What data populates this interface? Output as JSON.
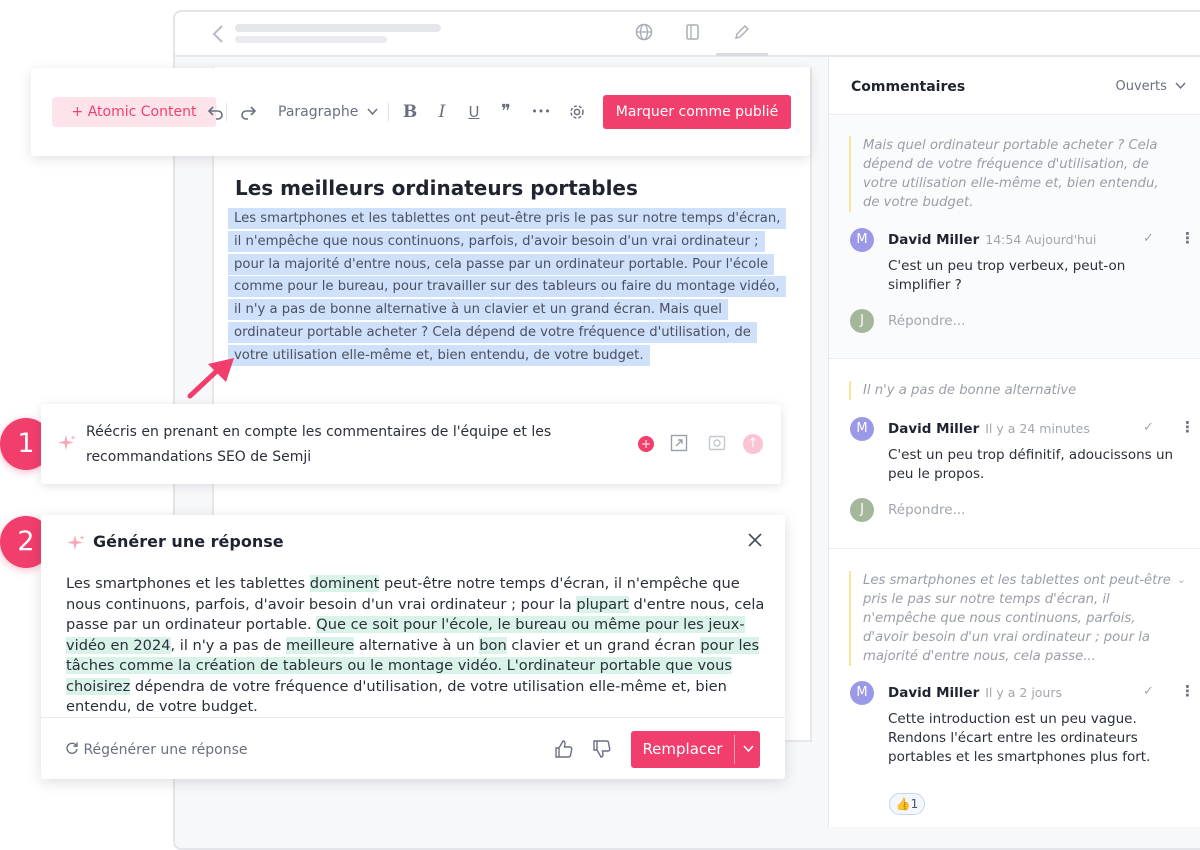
{
  "toolbar": {
    "atomic_label": "+ Atomic Content",
    "paragraph_label": "Paragraphe",
    "bold": "B",
    "italic": "I",
    "underline": "U",
    "quote": "❞",
    "more": "•••",
    "publish_label": "Marquer comme publié"
  },
  "article": {
    "title": "Les meilleurs ordinateurs portables",
    "body": "Les smartphones et les tablettes ont peut-être pris le pas sur notre temps d'écran, il n'empêche que nous continuons, parfois, d'avoir besoin d'un vrai ordinateur ; pour la majorité d'entre nous, cela passe par un ordinateur portable. Pour l'école comme pour le bureau, pour travailler sur des tableurs ou faire du montage vidéo, il n'y a pas de bonne alternative à un clavier et un grand écran. Mais quel ordinateur portable acheter ? Cela dépend de votre fréquence d'utilisation, de votre utilisation elle-même et, bien entendu, de votre budget."
  },
  "steps": {
    "one": "1",
    "two": "2"
  },
  "prompt": {
    "text": "Réécris en prenant en compte les commentaires de l'équipe et les recommandations SEO de Semji"
  },
  "generate": {
    "title": "Générer une réponse",
    "segments": [
      {
        "t": "Les smartphones et les tablettes ",
        "h": false
      },
      {
        "t": "dominent",
        "h": true
      },
      {
        "t": " peut-être notre temps d'écran, il n'empêche que nous continuons, parfois, d'avoir besoin d'un vrai ordinateur ; pour la ",
        "h": false
      },
      {
        "t": "plupart",
        "h": true
      },
      {
        "t": " d'entre nous, cela passe par un ordinateur portable. ",
        "h": false
      },
      {
        "t": "Que ce soit pour l'école, le bureau ou même pour les jeux-vidéo en 2024",
        "h": true
      },
      {
        "t": ", il n'y a pas de ",
        "h": false
      },
      {
        "t": "meilleure",
        "h": true
      },
      {
        "t": " alternative à un ",
        "h": false
      },
      {
        "t": "bon",
        "h": true
      },
      {
        "t": " clavier et un grand écran ",
        "h": false
      },
      {
        "t": "pour les tâches comme la création de tableurs ou le montage vidéo. L'ordinateur portable que vous choisirez",
        "h": true
      },
      {
        "t": " dépendra de votre fréquence d'utilisation, de votre utilisation elle-même et, bien entendu, de votre budget.",
        "h": false
      }
    ],
    "regen_label": "Régénérer une réponse",
    "replace_label": "Remplacer"
  },
  "comments": {
    "title": "Commentaires",
    "filter": "Ouverts",
    "reply_placeholder": "Répondre...",
    "threads": [
      {
        "quote": "Mais quel ordinateur portable acheter ? Cela dépend de votre fréquence d'utilisation, de votre utilisation elle-même et, bien entendu, de votre budget.",
        "author": "David Miller",
        "avatar": "M",
        "time": "14:54 Aujourd'hui",
        "text": "C'est un peu trop verbeux, peut-on simplifier ?",
        "reply_avatar": "J"
      },
      {
        "quote": "Il n'y a pas de bonne alternative",
        "author": "David Miller",
        "avatar": "M",
        "time": "Il y a 24 minutes",
        "text": "C'est un peu trop définitif, adoucissons un peu le propos.",
        "reply_avatar": "J"
      },
      {
        "quote": "Les smartphones et les tablettes ont peut-être pris le pas sur notre temps d'écran, il n'empêche que nous continuons, parfois, d'avoir besoin d'un vrai ordinateur ; pour la majorité d'entre nous, cela passe...",
        "author": "David Miller",
        "avatar": "M",
        "time": "Il y a 2 jours",
        "text": "Cette introduction est un peu vague. Rendons l'écart entre les ordinateurs portables et les smartphones plus fort.",
        "reaction": "👍1"
      }
    ]
  },
  "colors": {
    "brand": "#f23e6d",
    "highlight": "#cfe0fa",
    "suggestion": "#daf3e9",
    "quote_bar": "#f2e79c"
  }
}
